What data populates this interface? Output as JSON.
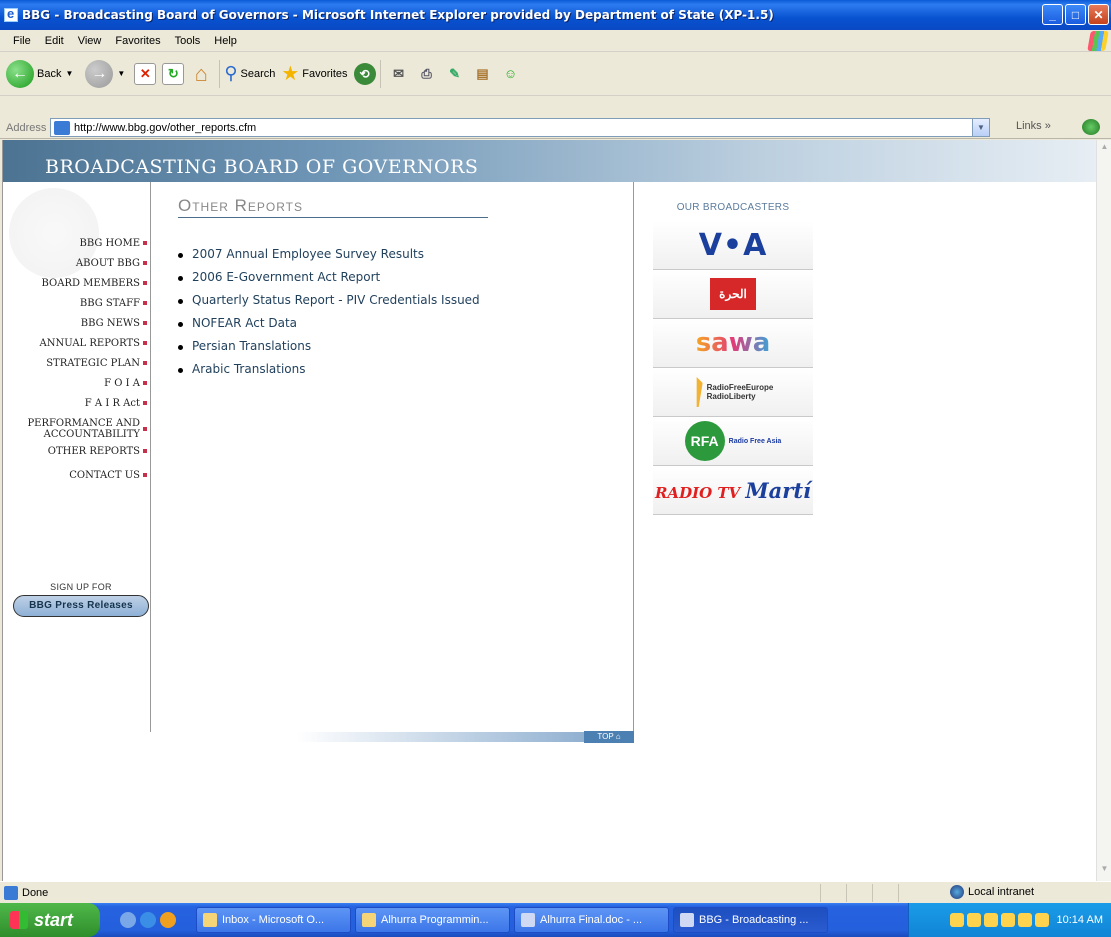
{
  "window": {
    "title": "BBG - Broadcasting Board of Governors - Microsoft Internet Explorer provided by Department of State (XP-1.5)"
  },
  "menu": [
    "File",
    "Edit",
    "View",
    "Favorites",
    "Tools",
    "Help"
  ],
  "toolbar": {
    "back_label": "Back",
    "search_label": "Search",
    "favorites_label": "Favorites"
  },
  "address": {
    "label": "Address",
    "url": "http://www.bbg.gov/other_reports.cfm",
    "links_label": "Links"
  },
  "page": {
    "banner": "BROADCASTING BOARD OF GOVERNORS",
    "title": "Other Reports",
    "nav": [
      "BBG HOME",
      "ABOUT BBG",
      "BOARD MEMBERS",
      "BBG STAFF",
      "BBG NEWS",
      "ANNUAL REPORTS",
      "STRATEGIC PLAN",
      "F O I A",
      "F A I R Act",
      "PERFORMANCE AND ACCOUNTABILITY",
      "OTHER REPORTS",
      "CONTACT US"
    ],
    "signup_label": "SIGN UP FOR",
    "press_button": "BBG Press Releases",
    "reports": [
      "2007 Annual Employee Survey Results",
      "2006 E-Government Act Report",
      "Quarterly Status Report - PIV Credentials Issued",
      "NOFEAR Act Data",
      "Persian Translations",
      "Arabic Translations"
    ],
    "top_label": "TOP",
    "broadcasters_heading": "OUR BROADCASTERS",
    "broadcasters": {
      "voa": "V•A",
      "alhurra": "الحرة",
      "sawa": "sawa",
      "rfe": [
        "RadioFreeEurope",
        "RadioLiberty"
      ],
      "rfa_mark": "RFA",
      "rfa_text": "Radio Free Asia",
      "marti_1": "RADIO TV",
      "marti_2": "Martí"
    }
  },
  "status": {
    "text": "Done",
    "zone": "Local intranet"
  },
  "taskbar": {
    "start": "start",
    "tasks": [
      "Inbox - Microsoft O...",
      "Alhurra Programmin...",
      "Alhurra Final.doc - ...",
      "BBG - Broadcasting ..."
    ],
    "clock": "10:14 AM"
  }
}
